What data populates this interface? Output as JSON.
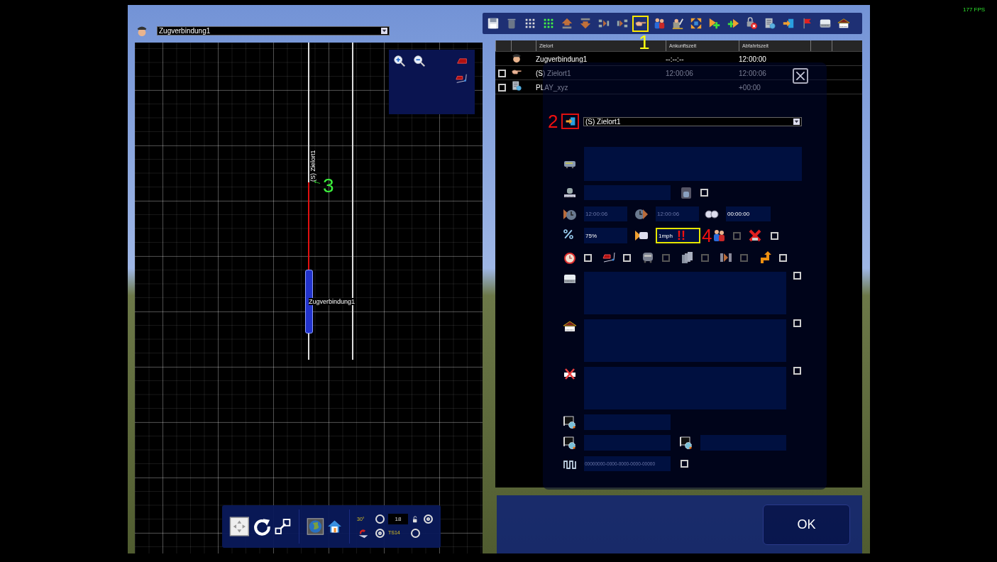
{
  "fps": "177 FPS",
  "map_panel": {
    "train_select": {
      "value": "Zugverbindung1"
    },
    "map": {
      "stop_label": "(S) Zielort1",
      "train_label": "Zugverbindung1",
      "callout": "3"
    },
    "bottom_toolbar": {
      "snap_angle": "30°",
      "grid_size": "18",
      "grid_label": "TS14",
      "toggles": [
        {
          "selected": false
        },
        {
          "selected": true
        },
        {
          "selected": true
        },
        {
          "selected": false
        }
      ]
    }
  },
  "toolbar": {
    "callout": "1",
    "buttons": [
      {
        "selected": false
      },
      {
        "selected": false
      },
      {
        "selected": false
      },
      {
        "selected": false
      },
      {
        "selected": false
      },
      {
        "selected": false
      },
      {
        "selected": false
      },
      {
        "selected": false
      },
      {
        "selected": true
      },
      {
        "selected": false
      },
      {
        "selected": false
      },
      {
        "selected": false
      },
      {
        "selected": false
      },
      {
        "selected": false
      },
      {
        "selected": false
      },
      {
        "selected": false
      },
      {
        "selected": false
      },
      {
        "selected": false
      },
      {
        "selected": false
      },
      {
        "selected": false
      }
    ]
  },
  "table": {
    "columns": [
      "Zielort",
      "Ankunftszeit",
      "Abfahrtszeit"
    ],
    "rows": [
      {
        "kind": "train",
        "destination": "Zugverbindung1",
        "arrival": "--:--:--",
        "departure": "12:00:00"
      },
      {
        "kind": "stop",
        "checked": false,
        "destination": "(S) Zielort1",
        "arrival": "12:00:06",
        "departure": "12:00:06"
      },
      {
        "kind": "script",
        "checked": false,
        "destination": "PLAY_xyz",
        "departure": "+00:00"
      }
    ]
  },
  "dialog": {
    "callout_2": "2",
    "destination": "(S) Zielort1",
    "arrival": "12:00:06",
    "departure": "12:00:06",
    "wait": "00:00:00",
    "percent": "75%",
    "speed": "1mph",
    "warning": "!!",
    "callout_4": "4",
    "id": "00000000-0000-0000-0000-00000",
    "checks": [
      {
        "checked": false,
        "disabled": false
      },
      {
        "checked": false,
        "disabled": true
      },
      {
        "checked": false,
        "disabled": false
      },
      {
        "checked": false,
        "disabled": false
      },
      {
        "checked": false,
        "disabled": false
      },
      {
        "checked": false,
        "disabled": true
      },
      {
        "checked": false,
        "disabled": true
      },
      {
        "checked": false,
        "disabled": true
      },
      {
        "checked": false,
        "disabled": false
      },
      {
        "checked": false,
        "disabled": false
      },
      {
        "checked": false,
        "disabled": false
      },
      {
        "checked": false,
        "disabled": false
      },
      {
        "checked": false,
        "disabled": false
      }
    ]
  },
  "ok_button": "OK"
}
